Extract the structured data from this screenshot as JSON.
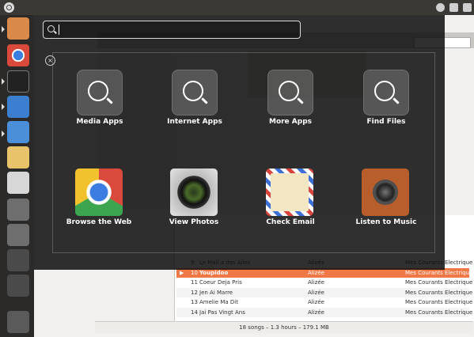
{
  "search": {
    "placeholder": "",
    "value": ""
  },
  "lenses": [
    {
      "label": "Media Apps",
      "icon": "play-lens-icon"
    },
    {
      "label": "Internet Apps",
      "icon": "globe-lens-icon"
    },
    {
      "label": "More Apps",
      "icon": "plus-lens-icon"
    },
    {
      "label": "Find Files",
      "icon": "file-lens-icon"
    }
  ],
  "apps": [
    {
      "label": "Browse the Web",
      "icon": "chrome-icon"
    },
    {
      "label": "View Photos",
      "icon": "camera-lens-icon"
    },
    {
      "label": "Check Email",
      "icon": "envelope-icon"
    },
    {
      "label": "Listen to Music",
      "icon": "speaker-icon"
    }
  ],
  "playlist": [
    {
      "num": "9",
      "title": "Le Mail a des Ailes",
      "artist": "Alizée",
      "album": "Mes Courants Electriques"
    },
    {
      "num": "10",
      "title": "Youpidoo",
      "artist": "Alizée",
      "album": "Mes Courants Electriques",
      "playing": true
    },
    {
      "num": "11",
      "title": "Coeur Deja Pris",
      "artist": "Alizée",
      "album": "Mes Courants Electriques"
    },
    {
      "num": "12",
      "title": "Jen Ai Marre",
      "artist": "Alizée",
      "album": "Mes Courants Electriques"
    },
    {
      "num": "13",
      "title": "Amelie Ma Dit",
      "artist": "Alizée",
      "album": "Mes Courants Electriques"
    },
    {
      "num": "14",
      "title": "Jai Pas Vingt Ans",
      "artist": "Alizée",
      "album": "Mes Courants Electriques"
    }
  ],
  "status": "18 songs – 1.3 hours – 179.1 MB",
  "colors": {
    "highlight": "#f07746",
    "launcher": "#2b2a28",
    "topbar": "#3a3936"
  }
}
